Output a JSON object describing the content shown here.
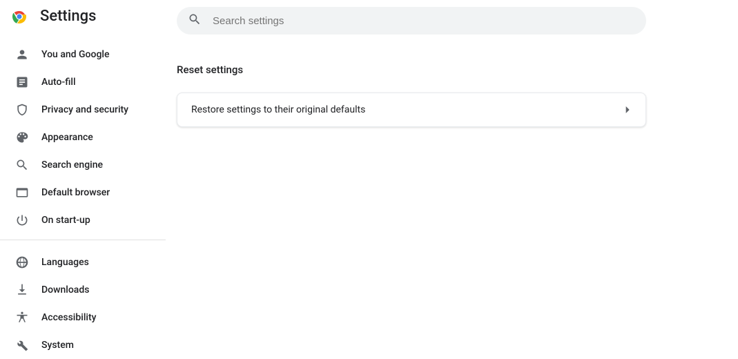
{
  "app_title": "Settings",
  "search": {
    "placeholder": "Search settings"
  },
  "sidebar": {
    "group1": [
      {
        "icon": "person",
        "label": "You and Google"
      },
      {
        "icon": "autofill",
        "label": "Auto-fill"
      },
      {
        "icon": "shield",
        "label": "Privacy and security"
      },
      {
        "icon": "palette",
        "label": "Appearance"
      },
      {
        "icon": "search",
        "label": "Search engine"
      },
      {
        "icon": "browser",
        "label": "Default browser"
      },
      {
        "icon": "power",
        "label": "On start-up"
      }
    ],
    "group2": [
      {
        "icon": "globe",
        "label": "Languages"
      },
      {
        "icon": "download",
        "label": "Downloads"
      },
      {
        "icon": "accessibility",
        "label": "Accessibility"
      },
      {
        "icon": "wrench",
        "label": "System"
      }
    ]
  },
  "main": {
    "section_title": "Reset settings",
    "reset_row": "Restore settings to their original defaults"
  }
}
